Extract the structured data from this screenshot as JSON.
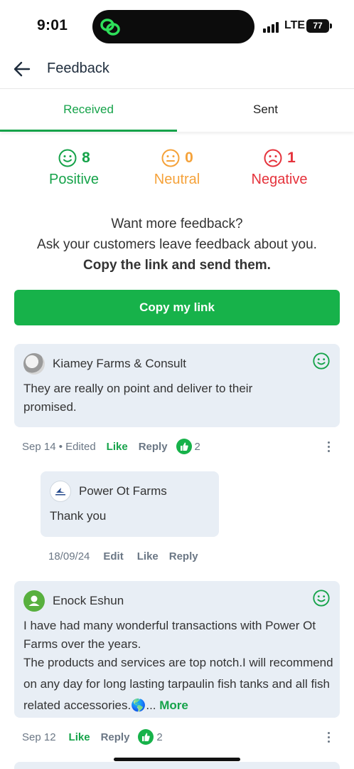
{
  "status": {
    "time": "9:01",
    "network": "LTE",
    "battery": "77"
  },
  "header": {
    "title": "Feedback",
    "back_icon": "arrow-left-icon"
  },
  "tabs": [
    {
      "label": "Received",
      "active": true
    },
    {
      "label": "Sent",
      "active": false
    }
  ],
  "counts": {
    "positive": {
      "value": "8",
      "label": "Positive",
      "color": "#16a34a"
    },
    "neutral": {
      "value": "0",
      "label": "Neutral",
      "color": "#f5a23a"
    },
    "negative": {
      "value": "1",
      "label": "Negative",
      "color": "#e5333c"
    }
  },
  "promo": {
    "line1": "Want more feedback?",
    "line2": "Ask your customers leave feedback about you.",
    "line3": "Copy the link and send them."
  },
  "copy_button": "Copy my link",
  "feedback": [
    {
      "author": "Kiamey Farms & Consult",
      "text": "They are really on point and deliver to their promised.",
      "date": "Sep 14 • Edited",
      "like": "Like",
      "reply": "Reply",
      "likes": "2",
      "reply_item": {
        "author": "Power Ot Farms",
        "text": "Thank you",
        "date": "18/09/24",
        "edit": "Edit",
        "like": "Like",
        "reply": "Reply"
      }
    },
    {
      "author": "Enock Eshun",
      "text": "I have had many wonderful transactions with Power Ot Farms over the years.",
      "text2": "The products and services are top notch.I will recommend on any day for long lasting tarpaulin fish tanks and all fish related accessories.🌎...",
      "more": "More",
      "date": "Sep 12",
      "like": "Like",
      "reply": "Reply",
      "likes": "2"
    }
  ],
  "colors": {
    "accent": "#16a34a",
    "card_bg": "#e8eef5",
    "button": "#17b24a"
  }
}
